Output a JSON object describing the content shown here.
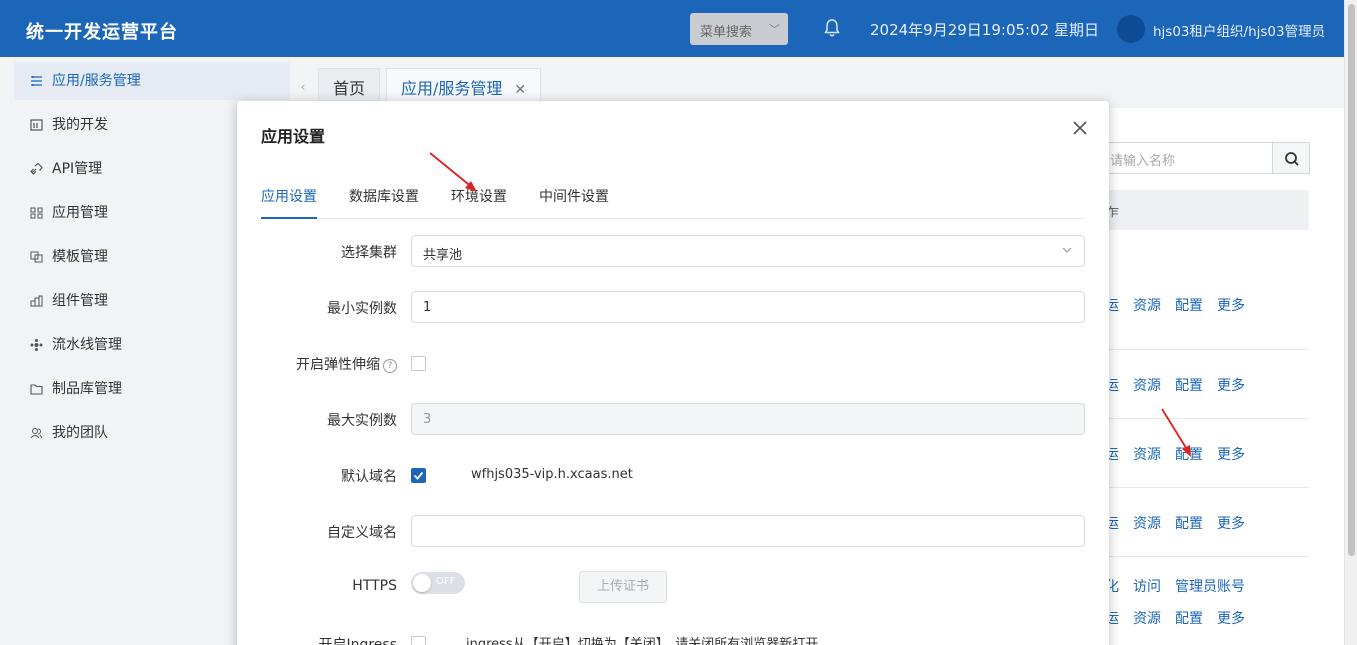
{
  "header": {
    "brand": "统一开发运营平台",
    "menu_search": "菜单搜索",
    "datetime": "2024年9月29日19:05:02 星期日",
    "user": "hjs03租户组织/hjs03管理员"
  },
  "sidebar": {
    "items": [
      {
        "label": "应用/服务管理",
        "icon": "list-icon"
      },
      {
        "label": "我的开发",
        "icon": "board-icon"
      },
      {
        "label": "API管理",
        "icon": "link-icon"
      },
      {
        "label": "应用管理",
        "icon": "grid-icon"
      },
      {
        "label": "模板管理",
        "icon": "template-icon"
      },
      {
        "label": "组件管理",
        "icon": "component-icon"
      },
      {
        "label": "流水线管理",
        "icon": "pipeline-icon"
      },
      {
        "label": "制品库管理",
        "icon": "folder-icon"
      },
      {
        "label": "我的团队",
        "icon": "team-icon"
      }
    ]
  },
  "page_tabs": [
    {
      "label": "首页"
    },
    {
      "label": "应用/服务管理",
      "close": "✕"
    }
  ],
  "content": {
    "search_placeholder": "请输入名称",
    "header_fragment": "乍",
    "rows": [
      [
        "运",
        "资源",
        "配置",
        "更多"
      ],
      [
        "运",
        "资源",
        "配置",
        "更多"
      ],
      [
        "运",
        "资源",
        "配置",
        "更多"
      ],
      [
        "运",
        "资源",
        "配置",
        "更多"
      ],
      [
        "化",
        "访问",
        "管理员账号"
      ],
      [
        "运",
        "资源",
        "配置",
        "更多"
      ]
    ]
  },
  "modal": {
    "title": "应用设置",
    "tabs": [
      "应用设置",
      "数据库设置",
      "环境设置",
      "中间件设置"
    ],
    "fields": {
      "cluster_label": "选择集群",
      "cluster_value": "共享池",
      "min_label": "最小实例数",
      "min_value": "1",
      "elastic_label": "开启弹性伸缩",
      "max_label": "最大实例数",
      "max_value": "3",
      "default_domain_label": "默认域名",
      "default_domain_value": "wfhjs035-vip.h.xcaas.net",
      "custom_domain_label": "自定义域名",
      "custom_domain_value": "",
      "https_label": "HTTPS",
      "https_state": "OFF",
      "upload_label": "上传证书",
      "ingress_label": "开启Ingress",
      "ingress_note": "ingress从【开启】切换为【关闭】，请关闭所有浏览器新打开"
    }
  },
  "colors": {
    "primary": "#1b66b8",
    "header_bg": "#1b66b8",
    "arrow": "#e02020"
  }
}
